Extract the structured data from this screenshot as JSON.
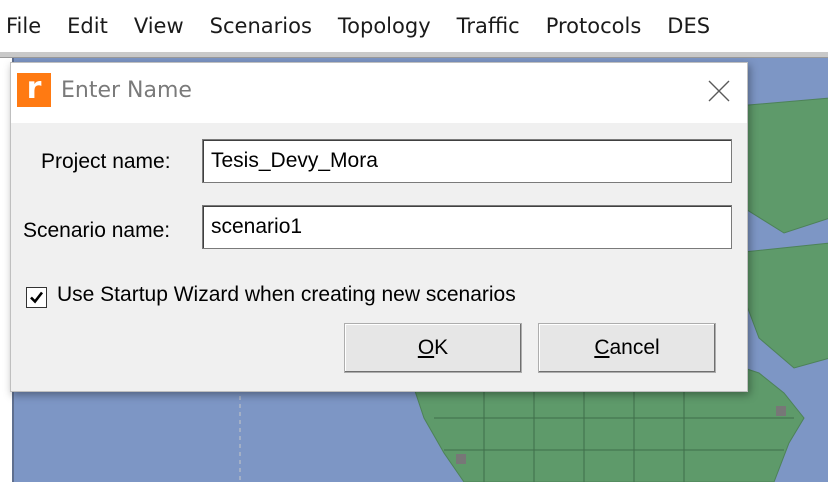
{
  "menubar": {
    "items": [
      "File",
      "Edit",
      "View",
      "Scenarios",
      "Topology",
      "Traffic",
      "Protocols",
      "DES"
    ]
  },
  "dialog": {
    "title": "Enter Name",
    "icon_letter": "r",
    "project_label": "Project name:",
    "project_value": "Tesis_Devy_Mora",
    "scenario_label": "Scenario name:",
    "scenario_value": "scenario1",
    "wizard_checkbox_label": "Use Startup Wizard when creating new scenarios",
    "wizard_checked": true,
    "ok_mnemonic": "O",
    "ok_rest": "K",
    "cancel_mnemonic": "C",
    "cancel_rest": "ancel"
  },
  "colors": {
    "map_ocean": "#7d96c5",
    "map_land": "#5e9a6a",
    "app_icon": "#ff7a12",
    "dialog_bg": "#f0f0f0"
  },
  "icons": {
    "app": "riverbed-app-icon",
    "close": "close-icon",
    "check": "checkmark-icon"
  }
}
